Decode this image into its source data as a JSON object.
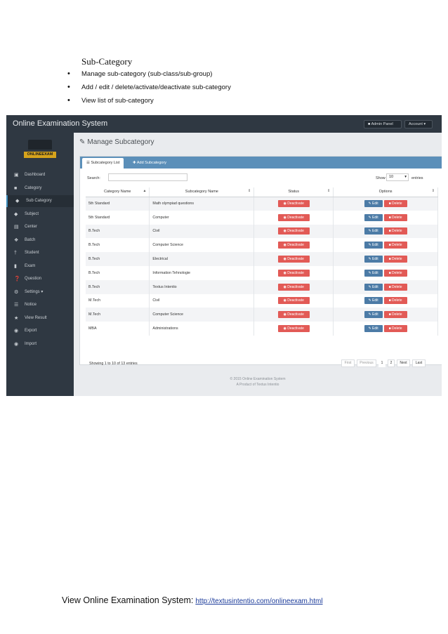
{
  "document": {
    "heading": "Sub-Category",
    "bullets": [
      "Manage sub-category (sub-class/sub-group)",
      "Add / edit / delete/activate/deactivate sub-category",
      "View list of sub-category"
    ],
    "footer_label": "View Online Examination System:",
    "footer_link": "http://textusintentio.com/onlineexam.html"
  },
  "app": {
    "brand": "Online Examination System",
    "admin_button": "Admin Panel",
    "account_button": "Account",
    "logo_text": "ONLINEEXAM",
    "sidebar": [
      {
        "label": "Dashboard",
        "icon": "monitor-icon"
      },
      {
        "label": "Category",
        "icon": "folder-icon"
      },
      {
        "label": "Sub Category",
        "icon": "tags-icon"
      },
      {
        "label": "Subject",
        "icon": "tag-icon"
      },
      {
        "label": "Center",
        "icon": "building-icon"
      },
      {
        "label": "Batch",
        "icon": "crosshair-icon"
      },
      {
        "label": "Student",
        "icon": "person-icon"
      },
      {
        "label": "Exam",
        "icon": "book-icon"
      },
      {
        "label": "Question",
        "icon": "question-icon"
      },
      {
        "label": "Settings",
        "icon": "cogs-icon"
      },
      {
        "label": "Notice",
        "icon": "list-icon"
      },
      {
        "label": "View Result",
        "icon": "trophy-icon"
      },
      {
        "label": "Export",
        "icon": "globe-icon"
      },
      {
        "label": "Import",
        "icon": "circle-icon"
      }
    ],
    "page_title": "Manage Subcategory",
    "tabs": {
      "list": "Subcategory List",
      "add": "Add Subcategory"
    },
    "search_label": "Search:",
    "show_label": "Show",
    "show_value": "10",
    "entries_label": "entries",
    "columns": [
      "Category Name",
      "Subcategory Name",
      "Status",
      "Options"
    ],
    "rows": [
      {
        "category": "5th Standard",
        "subcategory": "Math olympiad questions"
      },
      {
        "category": "5th Standard",
        "subcategory": "Computer"
      },
      {
        "category": "B.Tech",
        "subcategory": "Civil"
      },
      {
        "category": "B.Tech",
        "subcategory": "Computer Science"
      },
      {
        "category": "B.Tech",
        "subcategory": "Electrical"
      },
      {
        "category": "B.Tech",
        "subcategory": "Information Tehnologie"
      },
      {
        "category": "B.Tech",
        "subcategory": "Textus Intentio"
      },
      {
        "category": "M.Tech",
        "subcategory": "Civil"
      },
      {
        "category": "M.Tech",
        "subcategory": "Computer Science"
      },
      {
        "category": "MBA",
        "subcategory": "Administrations"
      }
    ],
    "deactivate_label": "Deactivate",
    "edit_label": "Edit",
    "delete_label": "Delete",
    "info_text": "Showing 1 to 10 of 13 entries",
    "pagination": [
      "First",
      "Previous",
      "1",
      "2",
      "Next",
      "Last"
    ],
    "footer_line1": "© 2015 Online Examination System",
    "footer_line2": "A Product of Textus Intentio"
  }
}
